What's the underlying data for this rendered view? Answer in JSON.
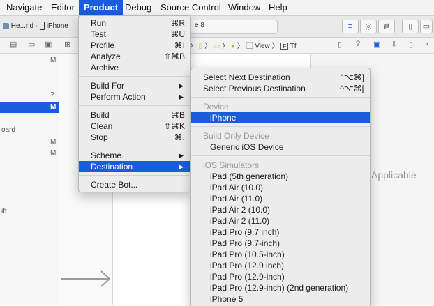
{
  "menubar": [
    "Navigate",
    "Editor",
    "Product",
    "Debug",
    "Source Control",
    "Window",
    "Help"
  ],
  "toolbar": {
    "scheme_project": "He...rld",
    "scheme_device": "iPhone",
    "activity_suffix": "e 8"
  },
  "jumpbar": {
    "view_label": "View",
    "tf_label": "Tf"
  },
  "navigator": {
    "badges": [
      "M",
      "?",
      "M",
      "M",
      "M"
    ],
    "partial_items": [
      "oard",
      "ift"
    ]
  },
  "inspector": {
    "placeholder": "Applicable"
  },
  "product_menu": {
    "groups": [
      [
        {
          "label": "Run",
          "shortcut": "⌘R"
        },
        {
          "label": "Test",
          "shortcut": "⌘U"
        },
        {
          "label": "Profile",
          "shortcut": "⌘I"
        },
        {
          "label": "Analyze",
          "shortcut": "⇧⌘B"
        },
        {
          "label": "Archive",
          "shortcut": ""
        }
      ],
      [
        {
          "label": "Build For",
          "shortcut": ""
        },
        {
          "label": "Perform Action",
          "shortcut": ""
        }
      ],
      [
        {
          "label": "Build",
          "shortcut": "⌘B"
        },
        {
          "label": "Clean",
          "shortcut": "⇧⌘K"
        },
        {
          "label": "Stop",
          "shortcut": "⌘."
        }
      ],
      [
        {
          "label": "Scheme",
          "shortcut": ""
        },
        {
          "label": "Destination",
          "shortcut": ""
        }
      ],
      [
        {
          "label": "Create Bot...",
          "shortcut": ""
        }
      ]
    ]
  },
  "destination_menu": {
    "select_next": {
      "label": "Select Next Destination",
      "shortcut": "^⌥⌘]"
    },
    "select_prev": {
      "label": "Select Previous Destination",
      "shortcut": "^⌥⌘["
    },
    "device_header": "Device",
    "device": "iPhone",
    "build_only_header": "Build Only Device",
    "generic": "Generic iOS Device",
    "simulators_header": "iOS Simulators",
    "simulators": [
      "iPad (5th generation)",
      "iPad Air (10.0)",
      "iPad Air (11.0)",
      "iPad Air 2 (10.0)",
      "iPad Air 2 (11.0)",
      "iPad Pro (9.7 inch)",
      "iPad Pro (9.7-inch)",
      "iPad Pro (10.5-inch)",
      "iPad Pro (12.9 inch)",
      "iPad Pro (12.9-inch)",
      "iPad Pro (12.9-inch) (2nd generation)",
      "iPhone 5"
    ]
  }
}
